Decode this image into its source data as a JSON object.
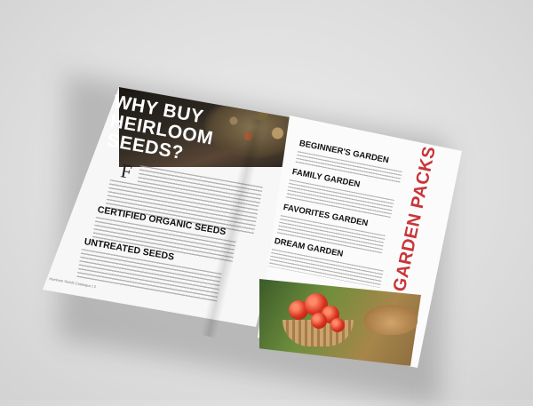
{
  "left_page": {
    "headline_lines": [
      "WHY BUY",
      "HEIRLOOM",
      "SEEDS?"
    ],
    "dropcap": "F",
    "subheads": [
      "CERTIFIED ORGANIC SEEDS",
      "UNTREATED SEEDS"
    ],
    "footer": "Heirloom Seeds Catalogue | 2"
  },
  "right_page": {
    "vertical_title": "GARDEN PACKS",
    "sections": [
      "BEGINNER'S GARDEN",
      "FAMILY GARDEN",
      "FAVORITES GARDEN",
      "DREAM GARDEN"
    ]
  },
  "colors": {
    "accent_red": "#c8363a",
    "page": "#f7f7f7",
    "background": "#dedede"
  }
}
